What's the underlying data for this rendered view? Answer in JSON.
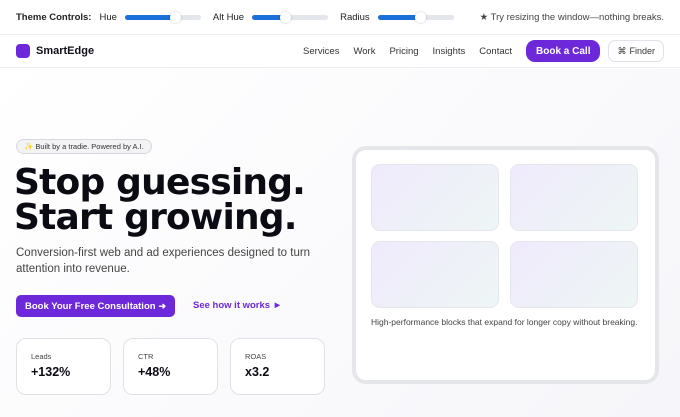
{
  "theme_controls": {
    "title": "Theme Controls:",
    "sliders": [
      {
        "label": "Hue",
        "value": 0.62
      },
      {
        "label": "Alt Hue",
        "value": 0.4
      },
      {
        "label": "Radius",
        "value": 0.52
      }
    ],
    "hint": "★ Try resizing the window—nothing breaks.",
    "accent_color": "#1a6fd8"
  },
  "header": {
    "brand": "SmartEdge",
    "brand_color": "#6d28d9",
    "nav": [
      "Services",
      "Work",
      "Pricing",
      "Insights",
      "Contact"
    ],
    "cta": "Book a Call",
    "finder": {
      "icon": "⌘",
      "label": "Finder"
    }
  },
  "hero": {
    "badge": "✨ Built by a tradie. Powered by A.I.",
    "headline_line1": "Stop guessing.",
    "headline_line2": "Start growing.",
    "subtitle": "Conversion-first web and ad experiences designed to turn attention into revenue.",
    "primary_cta": "Book Your Free Consultation",
    "primary_cta_icon": "➜",
    "secondary_cta": "See how it works ►",
    "stats": [
      {
        "label": "Leads",
        "value": "+132%"
      },
      {
        "label": "CTR",
        "value": "+48%"
      },
      {
        "label": "ROAS",
        "value": "x3.2"
      }
    ]
  },
  "preview": {
    "tiles": 4,
    "caption": "High-performance blocks that expand for longer copy without breaking."
  }
}
